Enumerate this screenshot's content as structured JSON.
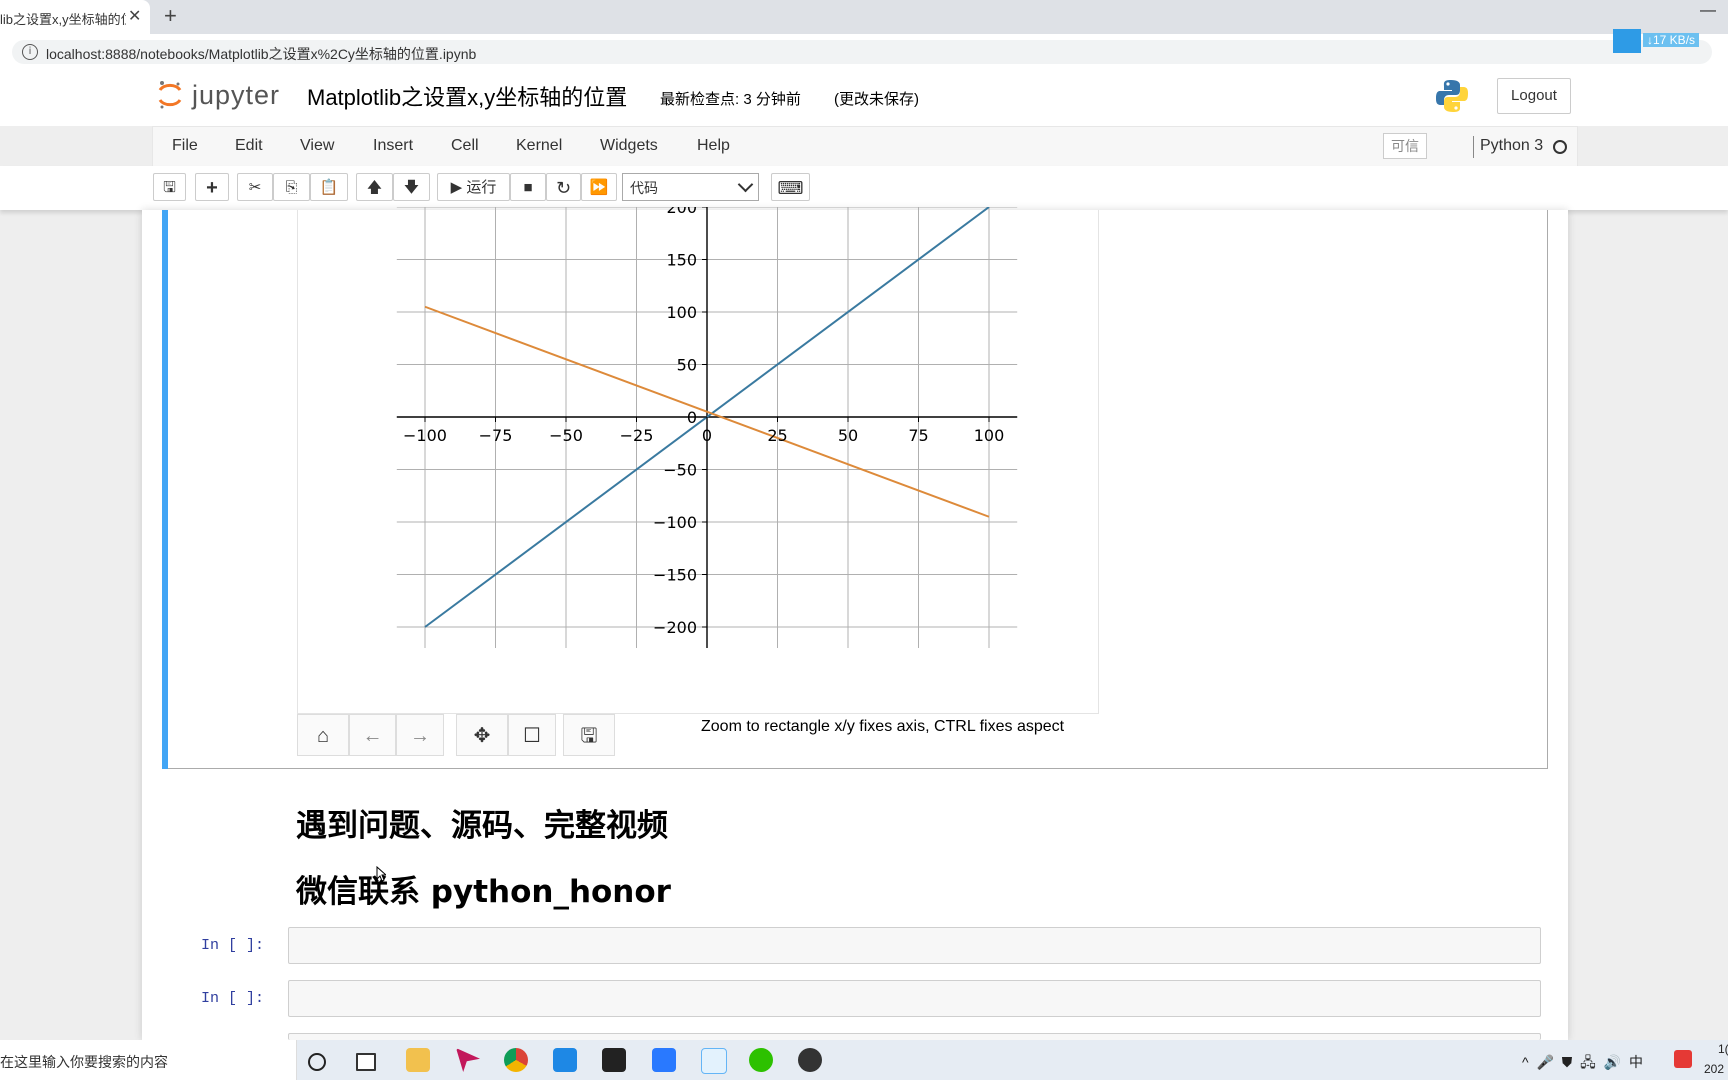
{
  "browser": {
    "tab_title": "lib之设置x,y坐标轴的位",
    "tab_close": "✕",
    "new_tab": "+",
    "url": "localhost:8888/notebooks/Matplotlib之设置x%2Cy坐标轴的位置.ipynb",
    "minimize": "—",
    "net_speed": "↓17 KB/s"
  },
  "header": {
    "logo_text": "jupyter",
    "notebook_title": "Matplotlib之设置x,y坐标轴的位置",
    "checkpoint": "最新检查点: 3 分钟前",
    "unsaved": "(更改未保存)",
    "logout_label": "Logout"
  },
  "menubar": {
    "items": [
      "File",
      "Edit",
      "View",
      "Insert",
      "Cell",
      "Kernel",
      "Widgets",
      "Help"
    ],
    "trusted": "可信",
    "kernel": "Python 3"
  },
  "toolbar": {
    "save": "🖫",
    "add": "+",
    "cut": "✂",
    "copy": "⎘",
    "paste": "📋",
    "move_up": "🡅",
    "move_down": "🡇",
    "run_label": "▶ 运行",
    "stop": "■",
    "restart": "↻",
    "fast_forward": "⏩",
    "cell_type": "代码",
    "keyboard": "⌨"
  },
  "figure": {
    "nav_home": "⌂",
    "nav_back": "←",
    "nav_forward": "→",
    "nav_pan": "✥",
    "nav_zoom": "☐",
    "nav_save": "🖫",
    "status_message": "Zoom to rectangle x/y fixes axis, CTRL fixes aspect"
  },
  "chart_data": {
    "type": "line",
    "x": [
      -100,
      100
    ],
    "series": [
      {
        "values": [
          -200,
          200
        ],
        "color": "#3a7aa0"
      },
      {
        "values": [
          105,
          -95
        ],
        "color": "#dd8a3a"
      }
    ],
    "xticks": [
      "−100",
      "−75",
      "−50",
      "−25",
      "0",
      "25",
      "50",
      "75",
      "100"
    ],
    "yticks": [
      "−200",
      "−150",
      "−100",
      "−50",
      "0",
      "50",
      "100",
      "150",
      "200"
    ],
    "xlim": [
      -110,
      110
    ],
    "ylim": [
      -220,
      200
    ],
    "grid": true,
    "spines": "centered at origin"
  },
  "markdown": {
    "heading1": "遇到问题、源码、完整视频",
    "heading2": "微信联系 python_honor"
  },
  "cells": [
    {
      "prompt": "In [ ]:"
    },
    {
      "prompt": "In [ ]:"
    }
  ],
  "taskbar": {
    "search_placeholder": "在这里输入你要搜索的内容",
    "tray": "^ 🎤 ⛊ 🖧 🔊 中",
    "clock_time": "1(",
    "clock_date": "202"
  }
}
